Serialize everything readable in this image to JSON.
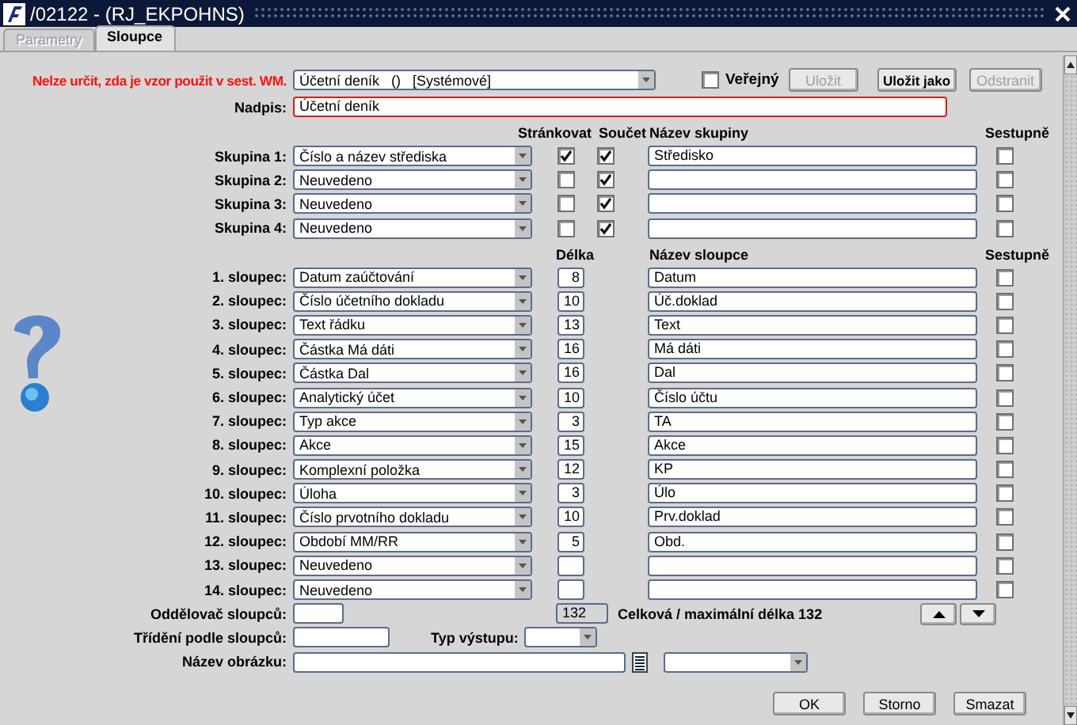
{
  "window": {
    "title": "/02122 - (RJ_EKPOHNS)"
  },
  "tabs": [
    {
      "label": "Parametry",
      "selected": false
    },
    {
      "label": "Sloupce",
      "selected": true
    }
  ],
  "template": {
    "message": "Nelze určit, zda je vzor použit v sest. WM.",
    "value": "Účetní deník   ()   [Systémové]",
    "public": {
      "label": "Veřejný",
      "checked": false
    }
  },
  "actions": [
    {
      "label": "Uložit",
      "disabled": true
    },
    {
      "label": "Uložit jako",
      "disabled": false
    },
    {
      "label": "Odstranit",
      "disabled": true
    }
  ],
  "heading": {
    "label": "Nadpis:",
    "value": "Účetní deník"
  },
  "groups": {
    "headers": {
      "paging": "Stránkovat",
      "sum": "Součet",
      "name": "Název skupiny",
      "descending": "Sestupně"
    },
    "rows": [
      {
        "label": "Skupina 1:",
        "value": "Číslo a název střediska",
        "paging": true,
        "sum": true,
        "name": "Středisko",
        "descending": false
      },
      {
        "label": "Skupina 2:",
        "value": "Neuvedeno",
        "paging": false,
        "sum": true,
        "descending": false
      },
      {
        "label": "Skupina 3:",
        "value": "Neuvedeno",
        "paging": false,
        "sum": true,
        "descending": false
      },
      {
        "label": "Skupina 4:",
        "value": "Neuvedeno",
        "paging": false,
        "sum": true,
        "descending": false
      }
    ]
  },
  "columns": {
    "headers": {
      "length": "Délka",
      "name": "Název sloupce",
      "descending": "Sestupně"
    },
    "rows": [
      {
        "label": "1. sloupec:",
        "value": "Datum zaúčtování",
        "length": "8",
        "name": "Datum",
        "descending": false
      },
      {
        "label": "2. sloupec:",
        "value": "Číslo účetního dokladu",
        "length": "10",
        "name": "Úč.doklad",
        "descending": false
      },
      {
        "label": "3. sloupec:",
        "value": "Text řádku",
        "length": "13",
        "name": "Text",
        "descending": false
      },
      {
        "label": "4. sloupec:",
        "value": "Částka Má dáti",
        "length": "16",
        "name": "Má dáti",
        "descending": false
      },
      {
        "label": "5. sloupec:",
        "value": "Částka Dal",
        "length": "16",
        "name": "Dal",
        "descending": false
      },
      {
        "label": "6. sloupec:",
        "value": "Analytický účet",
        "length": "10",
        "name": "Číslo účtu",
        "descending": false
      },
      {
        "label": "7. sloupec:",
        "value": "Typ akce",
        "length": "3",
        "name": "TA",
        "descending": false
      },
      {
        "label": "8. sloupec:",
        "value": "Akce",
        "length": "15",
        "name": "Akce",
        "descending": false
      },
      {
        "label": "9. sloupec:",
        "value": "Komplexní položka",
        "length": "12",
        "name": "KP",
        "descending": false
      },
      {
        "label": "10. sloupec:",
        "value": "Úloha",
        "length": "3",
        "name": "Úlo",
        "descending": false
      },
      {
        "label": "11. sloupec:",
        "value": "Číslo prvotního dokladu",
        "length": "10",
        "name": "Prv.doklad",
        "descending": false
      },
      {
        "label": "12. sloupec:",
        "value": "Období MM/RR",
        "length": "5",
        "name": "Obd.",
        "descending": false
      },
      {
        "label": "13. sloupec:",
        "value": "Neuvedeno",
        "descending": false
      },
      {
        "label": "14. sloupec:",
        "value": "Neuvedeno",
        "descending": false
      }
    ]
  },
  "separator": {
    "label": "Oddělovač sloupců:"
  },
  "total": {
    "value": "132",
    "text": "Celková / maximální délka 132"
  },
  "sort": {
    "label": "Třídění podle sloupců:"
  },
  "output_type": {
    "label": "Typ výstupu:"
  },
  "image_name": {
    "label": "Název obrázku:"
  },
  "footer_buttons": [
    {
      "label": "OK"
    },
    {
      "label": "Storno"
    },
    {
      "label": "Smazat"
    }
  ]
}
